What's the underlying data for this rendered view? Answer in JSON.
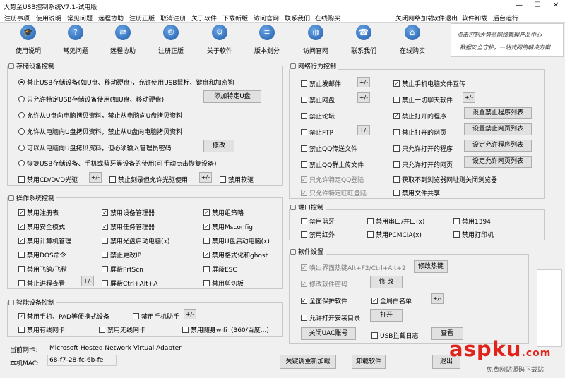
{
  "window": {
    "title": "大势至USB控制系统V7.1-试用版",
    "min": "—",
    "max": "☐",
    "close": "✕"
  },
  "menu": {
    "left": [
      "注册事项",
      "使用说明",
      "常见问题",
      "远程协助",
      "注册正版",
      "取消注册",
      "关于软件",
      "下载新版",
      "访问官网",
      "联系我们",
      "在线购买"
    ],
    "right": [
      "关闭网络加载",
      "软件退出",
      "软件卸载",
      "后台运行"
    ]
  },
  "toolbar": [
    {
      "label": "使用说明",
      "icon": "graduation-cap-icon",
      "glyph": "🎓"
    },
    {
      "label": "常见问题",
      "icon": "help-icon",
      "glyph": "?"
    },
    {
      "label": "远程协助",
      "icon": "remote-assist-icon",
      "glyph": "⇄"
    },
    {
      "label": "注册正版",
      "icon": "registered-icon",
      "glyph": "®"
    },
    {
      "label": "关于软件",
      "icon": "settings-icon",
      "glyph": "⚙"
    },
    {
      "label": "版本划分",
      "icon": "document-icon",
      "glyph": "≡"
    },
    {
      "label": "访问官网",
      "icon": "globe-icon",
      "glyph": "◍"
    },
    {
      "label": "联系我们",
      "icon": "phone-icon",
      "glyph": "☎"
    },
    {
      "label": "在线购买",
      "icon": "cart-icon",
      "glyph": "⌂"
    }
  ],
  "banner": {
    "line1": "点击控制大势至网络管理产品中心",
    "line2": "数据安全守护，一站式网络解决方案"
  },
  "storage": {
    "title": "存储设备控制",
    "radios": [
      {
        "label": "禁止USB存储设备(如U盘、移动硬盘)，允许使用USB鼠标、键盘和加密狗",
        "checked": true
      },
      {
        "label": "只允许特定USB存储设备使用(如U盘、移动硬盘)",
        "checked": false
      },
      {
        "label": "允许从U盘向电脑拷贝资料，禁止从电脑向U盘拷贝资料",
        "checked": false
      },
      {
        "label": "允许从电脑向U盘拷贝资料，禁止从U盘向电脑拷贝资料",
        "checked": false
      },
      {
        "label": "可以从电脑向U盘拷贝资料，但必须输入管理员密码",
        "checked": false
      },
      {
        "label": "恢复USB存储设备、手机或蓝牙等设备的使用(可手动点击恢复设备)",
        "checked": false
      }
    ],
    "add_usb_button": "添加特定U盘",
    "modify_button": "修改",
    "checks": [
      {
        "label": "禁用CD/DVD光驱",
        "checked": false
      },
      {
        "label": "禁止刻录但允许光驱使用",
        "checked": false
      },
      {
        "label": "禁用软驱",
        "checked": false
      }
    ],
    "pm": "+/-"
  },
  "os": {
    "title": "操作系统控制",
    "items": [
      [
        {
          "label": "禁用注册表",
          "checked": true
        },
        {
          "label": "禁用设备管理器",
          "checked": true
        },
        {
          "label": "禁用组策略",
          "checked": true
        }
      ],
      [
        {
          "label": "禁用安全模式",
          "checked": true
        },
        {
          "label": "禁用任务管理器",
          "checked": true
        },
        {
          "label": "禁用Msconfig",
          "checked": true
        }
      ],
      [
        {
          "label": "禁用计算机管理",
          "checked": true
        },
        {
          "label": "禁用光盘启动电脑(x)",
          "checked": false
        },
        {
          "label": "禁用U盘启动电脑(x)",
          "checked": false
        }
      ],
      [
        {
          "label": "禁用DOS命令",
          "checked": false
        },
        {
          "label": "禁止更改IP",
          "checked": false
        },
        {
          "label": "禁用格式化和ghost",
          "checked": true
        }
      ],
      [
        {
          "label": "禁用飞鸽/飞秋",
          "checked": false
        },
        {
          "label": "屏蔽PrtScn",
          "checked": false
        },
        {
          "label": "屏蔽ESC",
          "checked": false
        }
      ],
      [
        {
          "label": "禁止进程查看",
          "checked": false
        },
        {
          "label": "屏蔽Ctrl+Alt+A",
          "checked": false
        },
        {
          "label": "禁用剪切板",
          "checked": false
        }
      ]
    ],
    "pm": "+/-"
  },
  "smart": {
    "title": "智能设备控制",
    "items": [
      {
        "label": "禁用手机、PAD等便携式设备",
        "checked": true
      },
      {
        "label": "禁用手机助手",
        "checked": false
      },
      {
        "label": "禁用有线网卡",
        "checked": false
      },
      {
        "label": "禁用无线网卡",
        "checked": false
      },
      {
        "label": "禁用随身wifi（360/百度...）",
        "checked": false
      }
    ],
    "pm": "+/-"
  },
  "net": {
    "title": "网络行为控制",
    "left": [
      {
        "label": "禁止发邮件",
        "checked": false,
        "pm": true
      },
      {
        "label": "禁止网盘",
        "checked": false,
        "pm": true
      },
      {
        "label": "禁止论坛",
        "checked": false,
        "pm": false
      },
      {
        "label": "禁止FTP",
        "checked": false,
        "pm": true
      },
      {
        "label": "禁止QQ传送文件",
        "checked": false,
        "pm": false
      },
      {
        "label": "禁止QQ群上传文件",
        "checked": false,
        "pm": false
      },
      {
        "label": "只允许特定QQ登陆",
        "checked": true,
        "pm": false,
        "disabled": true
      },
      {
        "label": "只允许特定旺旺登陆",
        "checked": true,
        "pm": false,
        "disabled": true
      }
    ],
    "right": [
      {
        "label": "禁止手机电脑文件互传",
        "checked": true,
        "btn": ""
      },
      {
        "label": "禁止一切聊天软件",
        "checked": false,
        "btn": "+/-"
      },
      {
        "label": "禁止打开的程序",
        "checked": true,
        "btn": "设置禁止程序列表"
      },
      {
        "label": "禁止打开的网页",
        "checked": false,
        "btn": "设置禁止网页列表"
      },
      {
        "label": "只允许打开的程序",
        "checked": false,
        "btn": "设定允许程序列表"
      },
      {
        "label": "只允许打开的网页",
        "checked": false,
        "btn": "设定允许网页列表"
      },
      {
        "label": "获取不到浏览器网址则关闭浏览器",
        "checked": false,
        "btn": ""
      },
      {
        "label": "禁用文件共享",
        "checked": false,
        "btn": ""
      }
    ]
  },
  "port": {
    "title": "端口控制",
    "items": [
      {
        "label": "禁用蓝牙",
        "checked": false
      },
      {
        "label": "禁用串口/并口(x)",
        "checked": false
      },
      {
        "label": "禁用1394",
        "checked": false
      },
      {
        "label": "禁用红外",
        "checked": false
      },
      {
        "label": "禁用PCMCIA(x)",
        "checked": false
      },
      {
        "label": "禁用打印机",
        "checked": false
      }
    ]
  },
  "soft": {
    "title": "软件设置",
    "hotkey": {
      "label": "唤出界面热键Alt+F2/Ctrl+Alt+2",
      "button": "修改热键"
    },
    "password": {
      "label": "修改软件密码",
      "button": "修 改"
    },
    "protect": {
      "label": "全面保护软件",
      "checked": true
    },
    "whitelist": {
      "label": "全局白名单",
      "checked": true,
      "button": "+/-"
    },
    "setup": {
      "label": "允许打开安装目录",
      "checked": false,
      "button": "打开"
    },
    "uac_button": "关闭UAC账号",
    "usblog": {
      "label": "USB拦截日志",
      "checked": false,
      "button": "查看"
    }
  },
  "footer": {
    "nic_label": "当前网卡：",
    "nic_value": "Microsoft Hosted Network Virtual Adapter",
    "mac_label": "本机MAC:",
    "mac_value": "68-f7-28-fc-6b-fe",
    "reload_button": "关键调重新加载",
    "uninstall_button": "卸载软件",
    "run_button": "退出"
  },
  "watermark": {
    "main": "aspku",
    "tld": ".com",
    "sub": "免费网站源码下载站"
  }
}
